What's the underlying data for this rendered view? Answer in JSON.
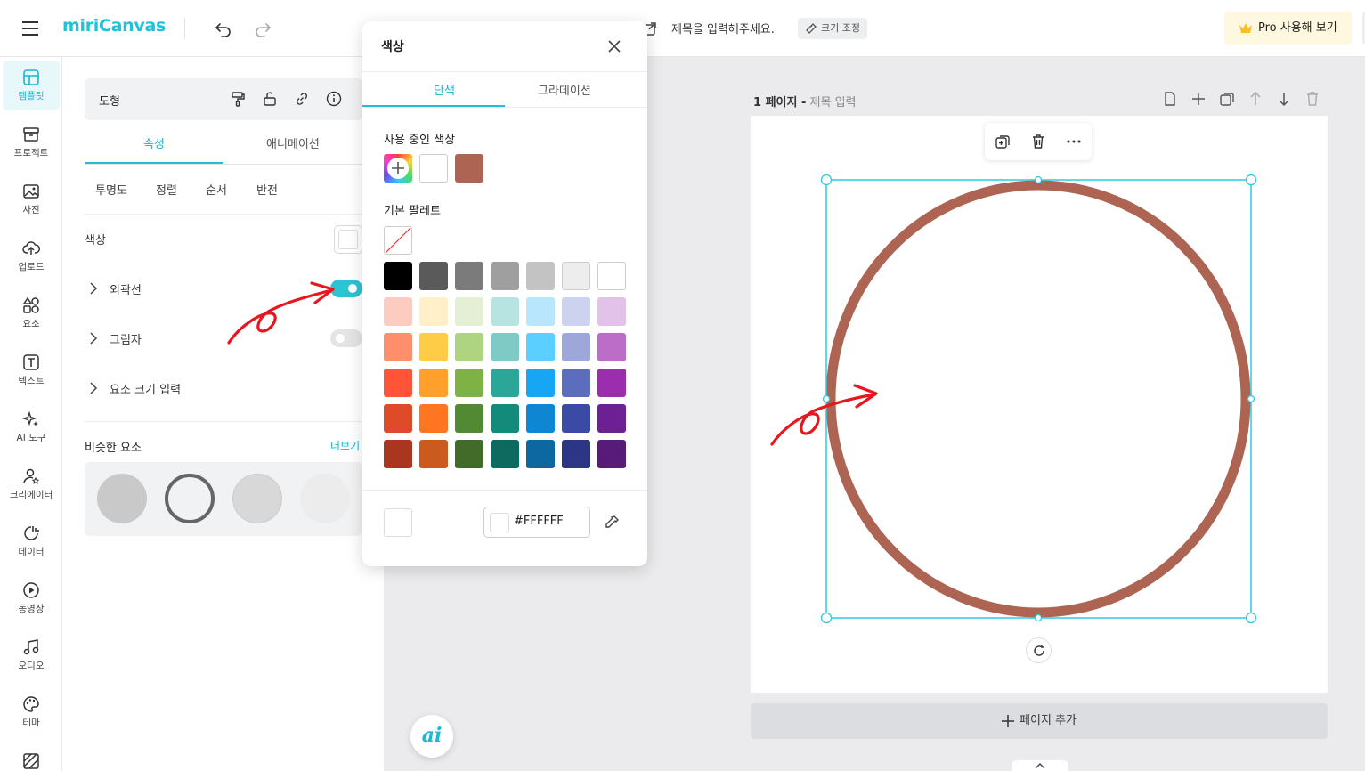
{
  "app": {
    "logo": "miriCanvas",
    "doc_title_placeholder": "제목을 입력해주세요.",
    "resize_label": "크기 조정",
    "pro_label": "Pro 사용해 보기"
  },
  "rail": [
    {
      "label": "템플릿",
      "icon": "template-icon"
    },
    {
      "label": "프로젝트",
      "icon": "project-icon"
    },
    {
      "label": "사진",
      "icon": "photo-icon"
    },
    {
      "label": "업로드",
      "icon": "upload-icon"
    },
    {
      "label": "요소",
      "icon": "elements-icon"
    },
    {
      "label": "텍스트",
      "icon": "text-icon"
    },
    {
      "label": "AI 도구",
      "icon": "ai-tools-icon"
    },
    {
      "label": "크리에이터",
      "icon": "creator-icon"
    },
    {
      "label": "데이터",
      "icon": "data-icon"
    },
    {
      "label": "동영상",
      "icon": "video-icon"
    },
    {
      "label": "오디오",
      "icon": "audio-icon"
    },
    {
      "label": "테마",
      "icon": "theme-icon"
    }
  ],
  "props": {
    "shape_title": "도형",
    "tabs": [
      "속성",
      "애니메이션"
    ],
    "subtabs": [
      "투명도",
      "정렬",
      "순서",
      "반전"
    ],
    "color_label": "색상",
    "outline_label": "외곽선",
    "shadow_label": "그림자",
    "size_label": "요소 크기 입력",
    "similar_title": "비슷한 요소",
    "similar_more": "더보기"
  },
  "canvas": {
    "page_label": "1 페이지 -",
    "page_title_placeholder": "제목 입력",
    "add_page_label": "페이지 추가"
  },
  "popup": {
    "title": "색상",
    "tabs": [
      "단색",
      "그라데이션"
    ],
    "used_title": "사용 중인 색상",
    "used_colors": [
      "#FFFFFF",
      "#AE6452"
    ],
    "palette_title": "기본 팔레트",
    "palette": [
      [
        "#000000",
        "#5A5A5A",
        "#7B7B7B",
        "#9F9F9F",
        "#C3C3C3",
        "#EDEDED",
        "#FFFFFF"
      ],
      [
        "#FDCCC0",
        "#FFF0C9",
        "#E4EFD6",
        "#B7E4E1",
        "#B8E6FD",
        "#CDD2F1",
        "#E3C2E9"
      ],
      [
        "#FF8E6C",
        "#FFCC47",
        "#AFD481",
        "#7FCAC5",
        "#5BCFFF",
        "#9EA7DA",
        "#BC6DC7"
      ],
      [
        "#FF5438",
        "#FFA02D",
        "#7EB245",
        "#2BA698",
        "#16A6F4",
        "#5C6DBE",
        "#9B2DAE"
      ],
      [
        "#DF4A28",
        "#FF7521",
        "#528A33",
        "#138A7A",
        "#0E86D1",
        "#3B4AA5",
        "#6D2093"
      ],
      [
        "#AB3620",
        "#CA5A1E",
        "#426B2A",
        "#0E6A5E",
        "#0D68A1",
        "#2C3684",
        "#581B79"
      ]
    ],
    "hex_value": "#FFFFFF"
  },
  "colors": {
    "accent": "#25BFD4",
    "stroke": "#AE6452",
    "annotation": "#E8161D"
  }
}
